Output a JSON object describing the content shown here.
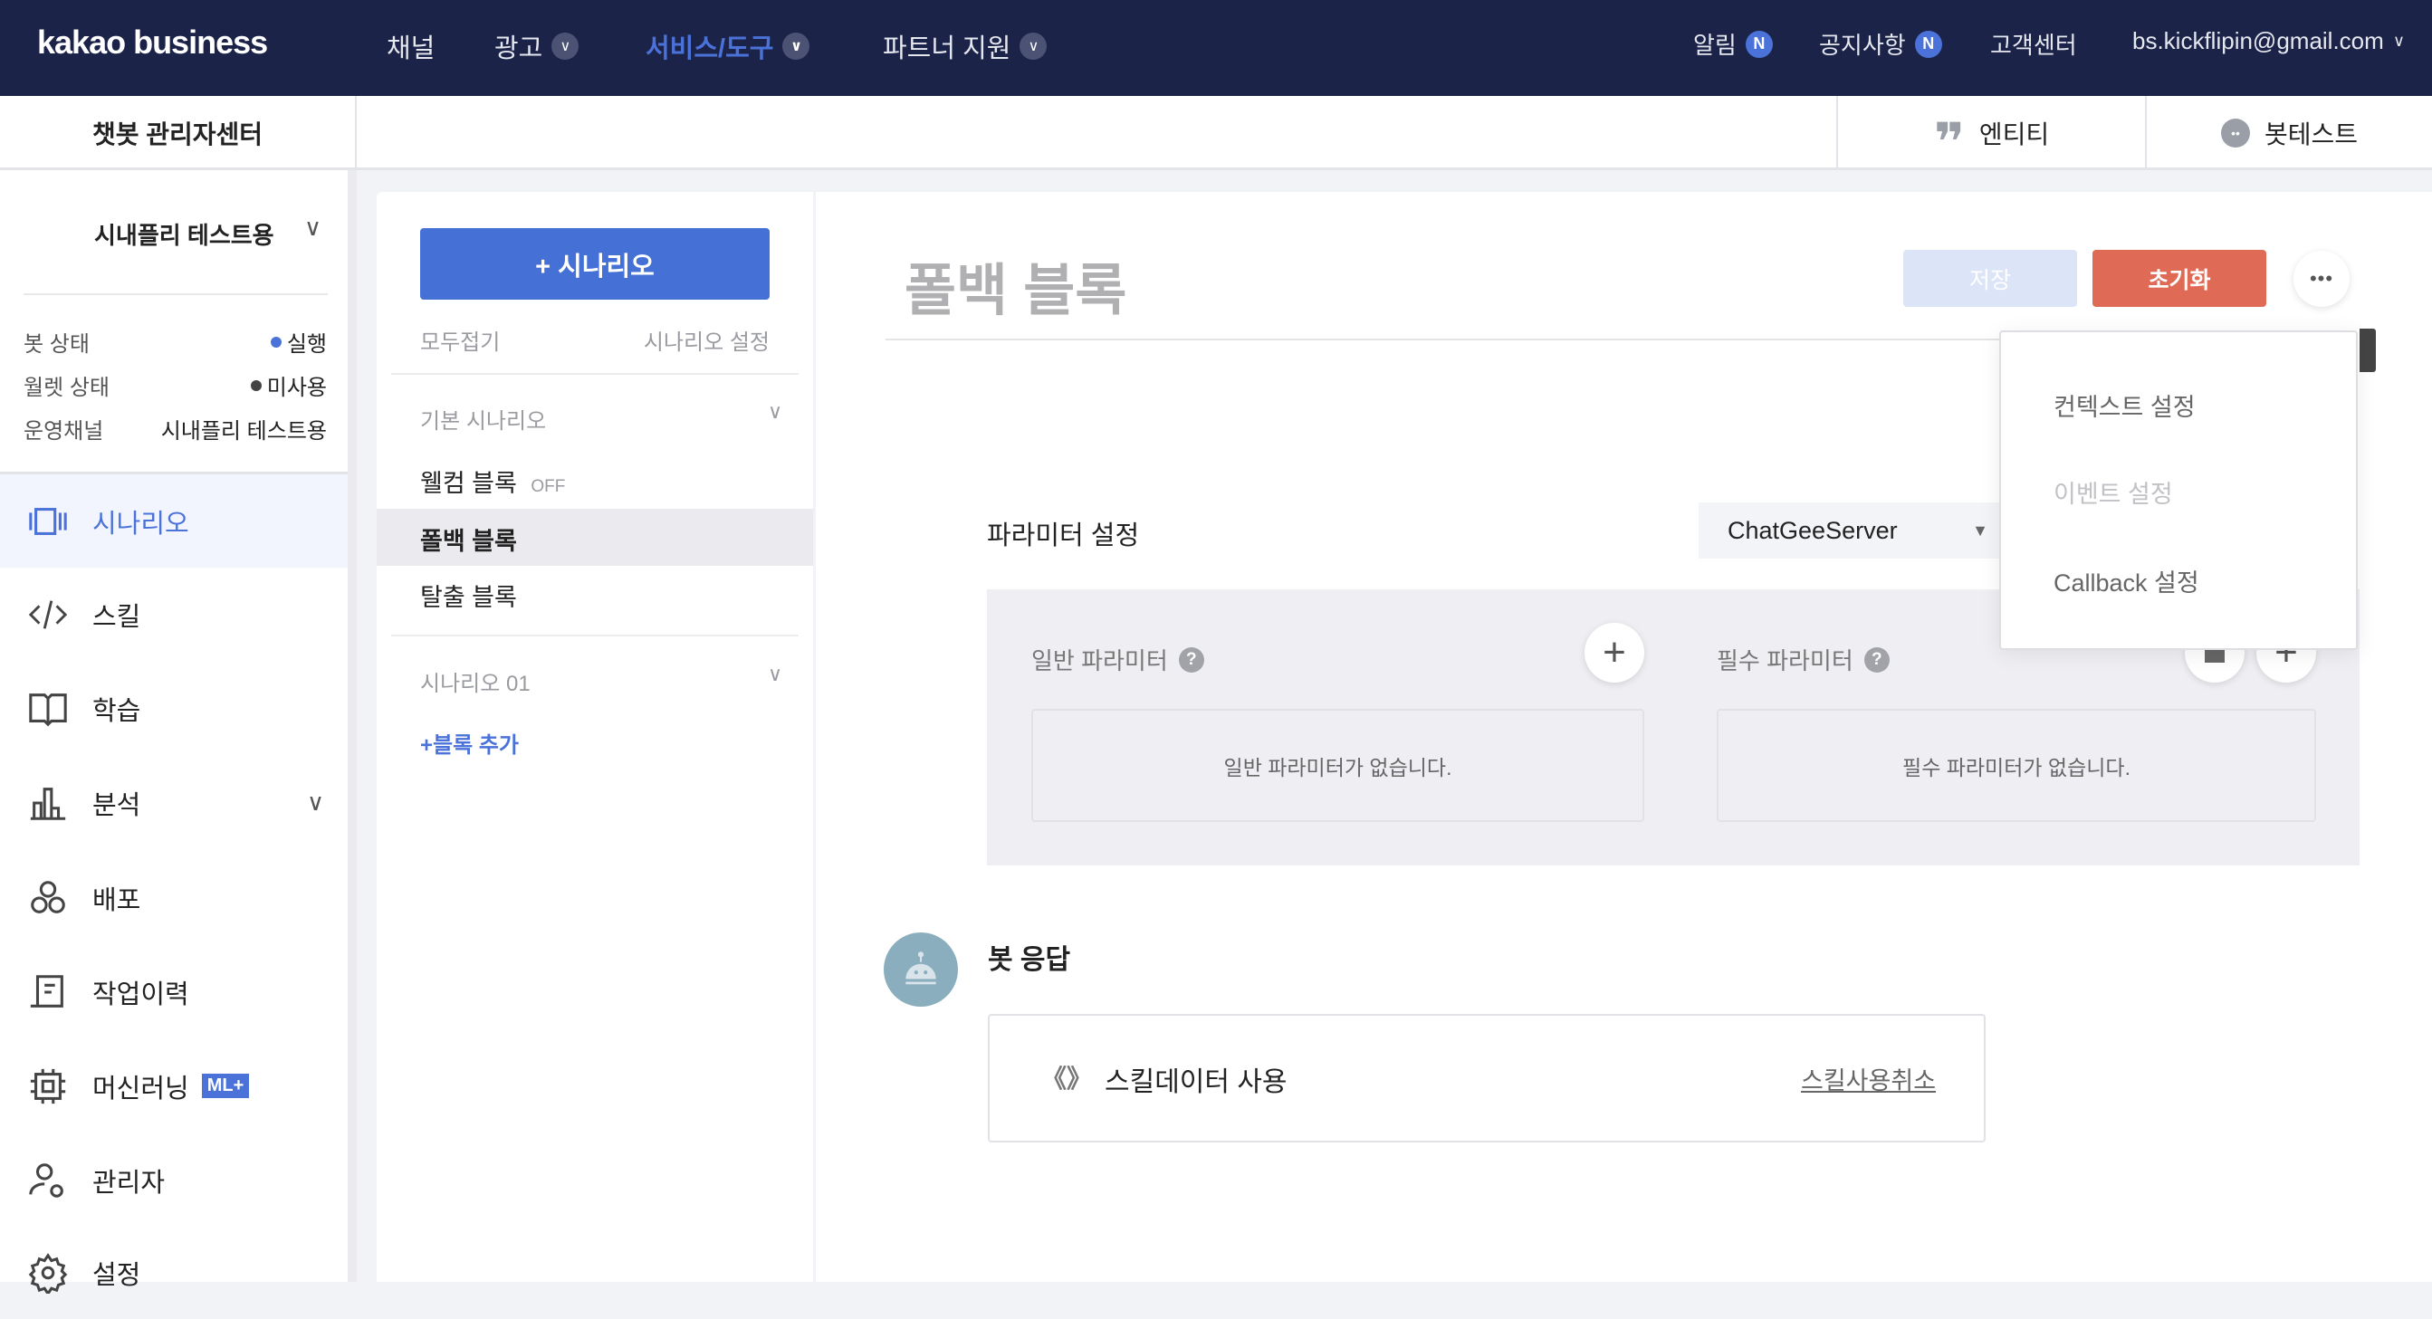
{
  "header": {
    "logo": "kakao business",
    "nav": [
      {
        "label": "채널"
      },
      {
        "label": "광고"
      },
      {
        "label": "서비스/도구"
      },
      {
        "label": "파트너 지원"
      }
    ],
    "right": {
      "alerts": "알림",
      "notices": "공지사항",
      "badge": "N",
      "support": "고객센터",
      "account": "bs.kickflipin@gmail.com"
    }
  },
  "subheader": {
    "title": "챗봇 관리자센터",
    "tabs": [
      {
        "label": "엔티티",
        "icon": "quote-icon"
      },
      {
        "label": "봇테스트",
        "icon": "chat-bubble-icon"
      }
    ]
  },
  "sidebar": {
    "bot_name": "시내플리 테스트용",
    "status": [
      {
        "label": "봇 상태",
        "value": "실행",
        "dot": "#4a72d9"
      },
      {
        "label": "월렛 상태",
        "value": "미사용",
        "dot": "#444444"
      },
      {
        "label": "운영채널",
        "value": "시내플리 테스트용"
      }
    ],
    "menu": [
      {
        "label": "시나리오",
        "icon": "scenario-icon",
        "active": true
      },
      {
        "label": "스킬",
        "icon": "code-icon"
      },
      {
        "label": "학습",
        "icon": "book-icon"
      },
      {
        "label": "분석",
        "icon": "bar-chart-icon"
      },
      {
        "label": "배포",
        "icon": "deploy-icon"
      },
      {
        "label": "작업이력",
        "icon": "history-icon"
      },
      {
        "label": "머신러닝",
        "icon": "chip-icon",
        "badge": "ML+"
      },
      {
        "label": "관리자",
        "icon": "admin-icon"
      },
      {
        "label": "설정",
        "icon": "gear-icon"
      }
    ]
  },
  "scenarios": {
    "add_button": "+ 시나리오",
    "collapse_all": "모두접기",
    "settings": "시나리오 설정",
    "groups": [
      {
        "title": "기본 시나리오",
        "blocks": [
          {
            "label": "웰컴 블록",
            "tag": "OFF"
          },
          {
            "label": "폴백 블록",
            "selected": true
          },
          {
            "label": "탈출 블록"
          }
        ]
      },
      {
        "title": "시나리오 01",
        "blocks": []
      }
    ],
    "add_block": "+블록 추가"
  },
  "main": {
    "title": "폴백 블록",
    "save": "저장",
    "reset": "초기화",
    "menu": [
      {
        "label": "컨텍스트 설정"
      },
      {
        "label": "이벤트 설정",
        "disabled": true
      },
      {
        "label": "Callback 설정"
      }
    ],
    "params": {
      "title": "파라미터 설정",
      "select": "ChatGeeServer",
      "general": "일반 파라미터",
      "required": "필수 파라미터",
      "help": "?",
      "general_empty": "일반 파라미터가 없습니다.",
      "required_empty": "필수 파라미터가 없습니다."
    },
    "response": {
      "title": "봇 응답",
      "skill_icon": "《》",
      "skill_label": "스킬데이터 사용",
      "cancel": "스킬사용취소"
    }
  },
  "colors": {
    "nav_bg": "#1c2349",
    "accent": "#4a72d9",
    "reset": "#df6a55",
    "save_disabled": "#dce4f7"
  }
}
